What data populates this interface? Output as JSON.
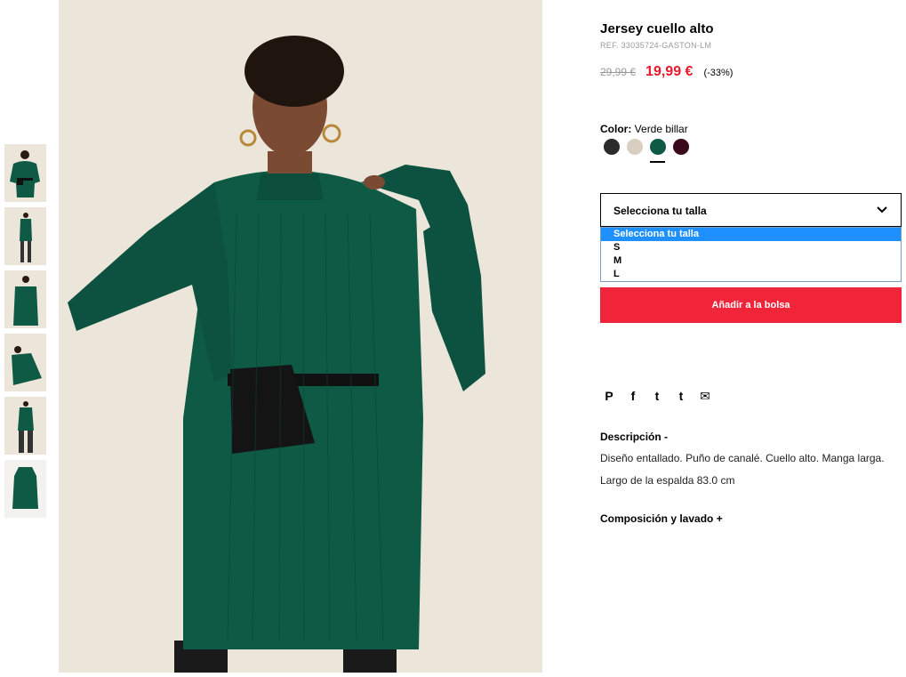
{
  "product": {
    "title": "Jersey cuello alto",
    "ref": "REF. 33035724-GASTON-LM",
    "old_price": "29,99 €",
    "new_price": "19,99 €",
    "discount": "(-33%)"
  },
  "color": {
    "label": "Color:",
    "value": "Verde billar",
    "swatches": [
      {
        "name": "black",
        "color": "#2b2b2b"
      },
      {
        "name": "cream",
        "color": "#d9cfc0"
      },
      {
        "name": "green",
        "color": "#0f5a45"
      },
      {
        "name": "burgundy",
        "color": "#3a0a1c"
      }
    ],
    "selected_index": 2
  },
  "size": {
    "placeholder": "Selecciona tu talla",
    "options": [
      "Selecciona tu talla",
      "S",
      "M",
      "L"
    ],
    "highlighted_index": 0
  },
  "actions": {
    "add_to_bag": "Añadir a la bolsa"
  },
  "share": {
    "icons": [
      "pinterest-icon",
      "facebook-icon",
      "twitter-icon",
      "tumblr-icon",
      "email-icon"
    ],
    "glyphs": [
      "P",
      "f",
      "t",
      "t",
      "✉"
    ]
  },
  "description": {
    "heading": "Descripción -",
    "text": "Diseño entallado. Puño de canalé. Cuello alto. Manga larga.",
    "length": "Largo de la espalda 83.0 cm"
  },
  "composition": {
    "heading": "Composición y lavado +"
  },
  "colors": {
    "accent_red": "#f0253a",
    "price_red": "#e8192c",
    "dress_green": "#0f5a45",
    "highlight_blue": "#1e90ff"
  }
}
